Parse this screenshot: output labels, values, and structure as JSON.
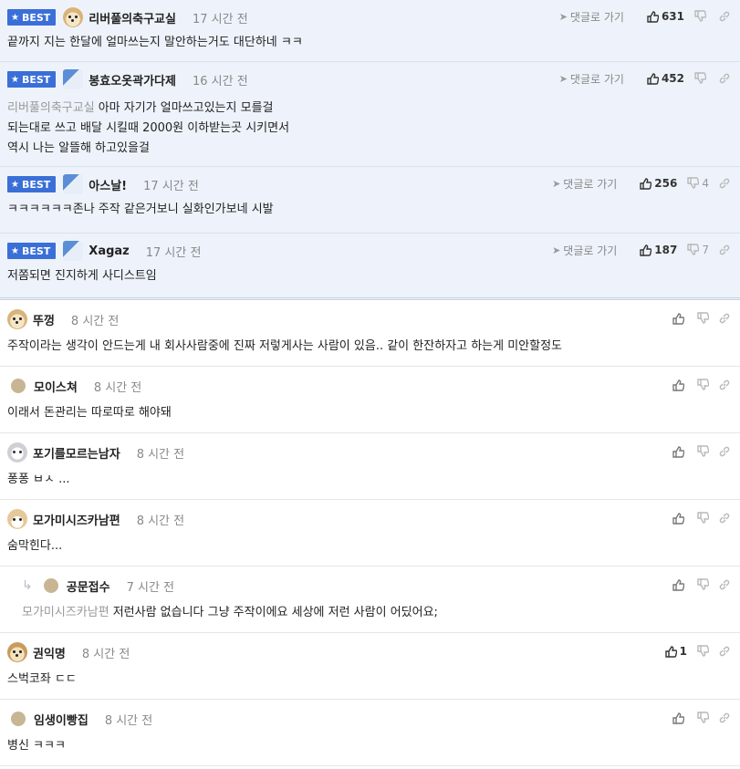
{
  "labels": {
    "best": "BEST",
    "goto_reply": "댓글로 가기"
  },
  "best_comments": [
    {
      "nick": "리버풀의축구교실",
      "time": "17 시간 전",
      "likes": "631",
      "dislikes": "",
      "lines": [
        "끝까지 지는 한달에 얼마쓰는지 말안하는거도 대단하네 ㅋㅋ"
      ],
      "mention": "",
      "avatar": "dog"
    },
    {
      "nick": "봉효오옷곽가다제",
      "time": "16 시간 전",
      "likes": "452",
      "dislikes": "",
      "mention": "리버풀의축구교실",
      "lines": [
        "아마 자기가 얼마쓰고있는지 모를걸",
        "되는대로 쓰고 배달 시킬때 2000원 이하받는곳 시키면서",
        "역시 나는 알뜰해 하고있을걸"
      ],
      "avatar": "blue"
    },
    {
      "nick": "아스날!",
      "time": "17 시간 전",
      "likes": "256",
      "dislikes": "4",
      "mention": "",
      "lines": [
        "ㅋㅋㅋㅋㅋㅋ존나 주작 같은거보니 실화인가보네 시발"
      ],
      "avatar": "blue"
    },
    {
      "nick": "Xagaz",
      "time": "17 시간 전",
      "likes": "187",
      "dislikes": "7",
      "mention": "",
      "lines": [
        "저쫌되면 진지하게 사디스트임"
      ],
      "avatar": "blue"
    }
  ],
  "comments": [
    {
      "nick": "뚜껑",
      "time": "8 시간 전",
      "likes": "",
      "text": "주작이라는 생각이 안드는게 내 회사사람중에 진짜 저렇게사는 사람이 있음.. 같이 한잔하자고 하는게 미안할정도",
      "mention": "",
      "reply": false,
      "avatar": "dog"
    },
    {
      "nick": "모이스쳐",
      "time": "8 시간 전",
      "likes": "",
      "text": "이래서 돈관리는 따로따로 해야돼",
      "mention": "",
      "reply": false,
      "avatar": "dot"
    },
    {
      "nick": "포기를모르는남자",
      "time": "8 시간 전",
      "likes": "",
      "text": "퐁퐁 ㅂㅅ ...",
      "mention": "",
      "reply": false,
      "avatar": "face"
    },
    {
      "nick": "모가미시즈카남편",
      "time": "8 시간 전",
      "likes": "",
      "text": "숨막힌다...",
      "mention": "",
      "reply": false,
      "avatar": "fox"
    },
    {
      "nick": "공문접수",
      "time": "7 시간 전",
      "likes": "",
      "text": "저런사람 없습니다 그냥 주작이에요 세상에 저런 사람이 어딨어요;",
      "mention": "모가미시즈카남편",
      "reply": true,
      "avatar": "dot"
    },
    {
      "nick": "권익명",
      "time": "8 시간 전",
      "likes": "1",
      "text": "스벅코좌 ㄷㄷ",
      "mention": "",
      "reply": false,
      "avatar": "dog2"
    },
    {
      "nick": "임생이빵집",
      "time": "8 시간 전",
      "likes": "",
      "text": "병신 ㅋㅋㅋ",
      "mention": "",
      "reply": false,
      "avatar": "dot"
    }
  ],
  "colors": {
    "best_badge": "#3b6fd8",
    "best_bg": "#eef3fb"
  }
}
